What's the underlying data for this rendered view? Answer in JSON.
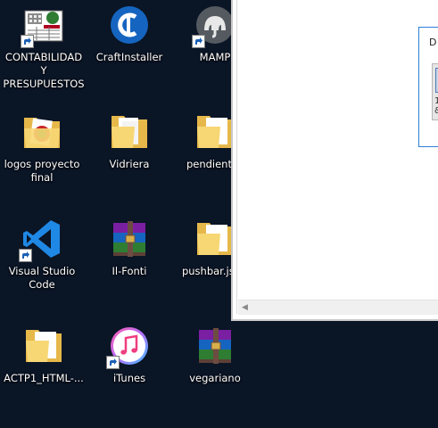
{
  "desktop": {
    "icons": [
      {
        "label": "CONTABILIDAD Y PRESUPUESTOS",
        "icon": "accounting-app-icon",
        "shortcut": true
      },
      {
        "label": "CraftInstaller",
        "icon": "craft-installer-icon",
        "shortcut": false
      },
      {
        "label": "MAMP",
        "icon": "mamp-elephant-icon",
        "shortcut": true
      },
      {
        "label": "logos proyecto final",
        "icon": "folder-icon",
        "shortcut": false
      },
      {
        "label": "Vidriera",
        "icon": "folder-icon",
        "shortcut": false
      },
      {
        "label": "pendientes",
        "icon": "folder-icon",
        "shortcut": false
      },
      {
        "label": "Visual Studio Code",
        "icon": "vscode-icon",
        "shortcut": true
      },
      {
        "label": "Il-Fonti",
        "icon": "winrar-archive-icon",
        "shortcut": false
      },
      {
        "label": "pushbar.js-m",
        "icon": "folder-icon",
        "shortcut": false
      },
      {
        "label": "ACTP1_HTML-...",
        "icon": "folder-icon",
        "shortcut": false
      },
      {
        "label": "iTunes",
        "icon": "itunes-icon",
        "shortcut": true
      },
      {
        "label": "vegariano",
        "icon": "winrar-archive-icon",
        "shortcut": false
      }
    ]
  },
  "dialog": {
    "title": "D",
    "preview_text": "1\n&"
  },
  "colors": {
    "desktop_bg": "#0a1526",
    "dialog_border": "#2f7fd8",
    "window_bg": "#ffffff"
  }
}
